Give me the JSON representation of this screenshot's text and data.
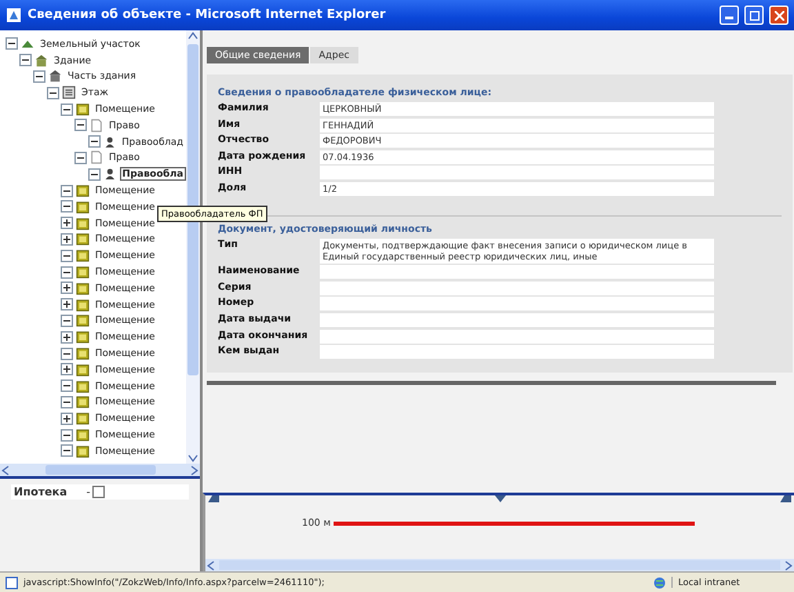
{
  "window": {
    "title": "Сведения об объекте - Microsoft Internet Explorer"
  },
  "tree": [
    {
      "label": "Земельный участок",
      "kind": "parcel",
      "expanded": true,
      "selected": false,
      "children": [
        {
          "label": "Здание",
          "kind": "building",
          "expanded": true,
          "selected": false,
          "children": [
            {
              "label": "Часть здания",
              "kind": "part",
              "expanded": true,
              "selected": false,
              "children": [
                {
                  "label": "Этаж",
                  "kind": "floor",
                  "expanded": true,
                  "selected": false,
                  "children": [
                    {
                      "label": "Помещение",
                      "kind": "room",
                      "expanded": true,
                      "selected": false,
                      "children": [
                        {
                          "label": "Право",
                          "kind": "right",
                          "expanded": true,
                          "selected": false,
                          "children": [
                            {
                              "label": "Правооблад",
                              "kind": "holder",
                              "expanded": true,
                              "selected": false
                            }
                          ]
                        },
                        {
                          "label": "Право",
                          "kind": "right",
                          "expanded": true,
                          "selected": false,
                          "children": [
                            {
                              "label": "Правообла",
                              "kind": "holder",
                              "expanded": true,
                              "selected": true
                            }
                          ]
                        }
                      ]
                    },
                    {
                      "label": "Помещение",
                      "kind": "room",
                      "expanded": true,
                      "selected": false
                    },
                    {
                      "label": "Помещение",
                      "kind": "room",
                      "expanded": true,
                      "selected": false
                    },
                    {
                      "label": "Помещение",
                      "kind": "room",
                      "expanded": false,
                      "selected": false
                    },
                    {
                      "label": "Помещение",
                      "kind": "room",
                      "expanded": false,
                      "selected": false
                    },
                    {
                      "label": "Помещение",
                      "kind": "room",
                      "expanded": true,
                      "selected": false
                    },
                    {
                      "label": "Помещение",
                      "kind": "room",
                      "expanded": true,
                      "selected": false
                    },
                    {
                      "label": "Помещение",
                      "kind": "room",
                      "expanded": false,
                      "selected": false
                    },
                    {
                      "label": "Помещение",
                      "kind": "room",
                      "expanded": false,
                      "selected": false
                    },
                    {
                      "label": "Помещение",
                      "kind": "room",
                      "expanded": true,
                      "selected": false
                    },
                    {
                      "label": "Помещение",
                      "kind": "room",
                      "expanded": false,
                      "selected": false
                    },
                    {
                      "label": "Помещение",
                      "kind": "room",
                      "expanded": true,
                      "selected": false
                    },
                    {
                      "label": "Помещение",
                      "kind": "room",
                      "expanded": false,
                      "selected": false
                    },
                    {
                      "label": "Помещение",
                      "kind": "room",
                      "expanded": true,
                      "selected": false
                    },
                    {
                      "label": "Помещение",
                      "kind": "room",
                      "expanded": true,
                      "selected": false
                    },
                    {
                      "label": "Помещение",
                      "kind": "room",
                      "expanded": false,
                      "selected": false
                    },
                    {
                      "label": "Помещение",
                      "kind": "room",
                      "expanded": true,
                      "selected": false
                    },
                    {
                      "label": "Помещение",
                      "kind": "room",
                      "expanded": true,
                      "selected": false
                    }
                  ]
                }
              ]
            }
          ]
        }
      ]
    }
  ],
  "tooltip": "Правообладатель ФП",
  "layers": [
    {
      "label": "Ипотека",
      "prefix": "-",
      "checked": false
    }
  ],
  "tabs": [
    {
      "label": "Общие сведения",
      "selected": true
    },
    {
      "label": "Адрес",
      "selected": false
    }
  ],
  "sections": [
    {
      "title": "Сведения о правообладателе физическом лице:",
      "fields": [
        {
          "label": "Фамилия",
          "value": "ЦЕРКОВНЫЙ"
        },
        {
          "label": "Имя",
          "value": "ГЕННАДИЙ"
        },
        {
          "label": "Отчество",
          "value": "ФЕДОРОВИЧ"
        },
        {
          "label": "Дата рождения",
          "value": "07.04.1936"
        },
        {
          "label": "ИНН"
        },
        {
          "label": "Доля",
          "value": "1/2"
        }
      ]
    },
    {
      "title": "Документ, удостоверяющий личность",
      "fields": [
        {
          "label": "Тип",
          "value": "Документы, подтверждающие факт внесения записи о юридическом лице в Единый государственный реестр юридических лиц, иные"
        },
        {
          "label": "Наименование"
        },
        {
          "label": "Серия"
        },
        {
          "label": "Номер"
        },
        {
          "label": "Дата выдачи"
        },
        {
          "label": "Дата окончания"
        },
        {
          "label": "Кем выдан"
        }
      ]
    }
  ],
  "map": {
    "scale_label": "100 м"
  },
  "status_bar": {
    "text": "javascript:ShowInfo(\"/ZokzWeb/Info/Info.aspx?parcelw=2461110\");",
    "zone": "Local intranet"
  }
}
